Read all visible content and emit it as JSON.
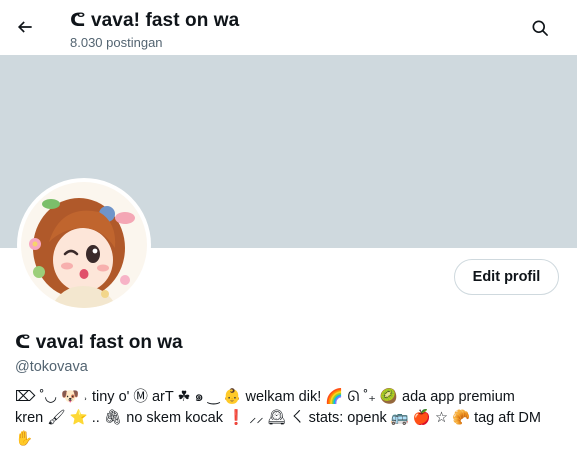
{
  "header": {
    "title": "ᕦ vava! fast on wa",
    "post_count": "8.030 postingan",
    "back_icon": "arrow-left-icon",
    "search_icon": "search-icon"
  },
  "banner": {
    "color": "#cfd9de"
  },
  "profile": {
    "name": "ᕦ vava! fast on wa",
    "handle": "@tokovava",
    "edit_button": "Edit profil",
    "avatar_icon": "avatar-illustration"
  },
  "bio": {
    "line1": "⌦ ˚◡ 🐶 ˒ tiny o' Ⓜ arT ☘ ๑ ‿ 👶 welkam dik! 🌈 ᘏ ˚₊ 🥝 ada app premium",
    "line2": "kren 🖌 ⭐ .. 🖇 no skem kocak ❗ ⸝⸝ 🕰 ㄑ stats: openk 🚌 🍎 ☆ 🥐 tag aft DM",
    "line3": "✋"
  },
  "colors": {
    "text": "#0f1419",
    "muted": "#536471",
    "border": "#cfd9de",
    "background": "#ffffff"
  }
}
